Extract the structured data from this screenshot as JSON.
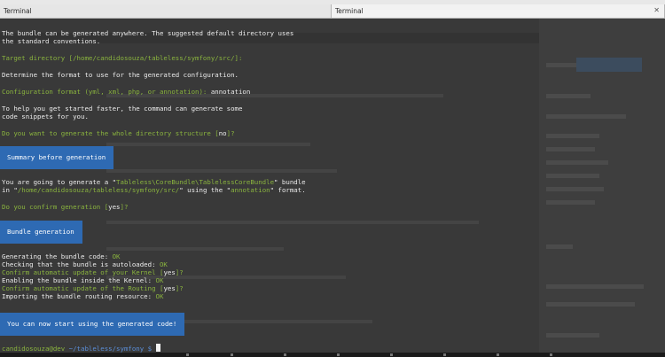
{
  "tabs": [
    {
      "label": "Terminal"
    },
    {
      "label": "Terminal"
    }
  ],
  "terminal": {
    "intro_1": "The bundle can be generated anywhere. The suggested default directory uses",
    "intro_2": "the standard conventions.",
    "target_label": "Target directory [",
    "target_default": "/home/candidosouza/tableless/symfony/src/",
    "target_close": "]:",
    "format_intro": "Determine the format to use for the generated configuration.",
    "format_prompt": "Configuration format (yml, xml, php, or annotation): ",
    "format_answer": "annotation",
    "snippets_1": "To help you get started faster, the command can generate some",
    "snippets_2": "code snippets for you.",
    "structure_prompt": "Do you want to generate the whole directory structure [",
    "structure_default": "no",
    "structure_close": "]?",
    "summary_block": "Summary before generation",
    "gen_1a": "You are going to generate a \"",
    "gen_1b": "Tableless\\CoreBundle\\TablelessCoreBundle",
    "gen_1c": "\" bundle",
    "gen_2a": "in \"",
    "gen_2b": "/home/candidosouza/tableless/symfony/src/",
    "gen_2c": "\" using the \"",
    "gen_2d": "annotation",
    "gen_2e": "\" format.",
    "confirm_prompt": "Do you confirm generation [",
    "confirm_default": "yes",
    "confirm_close": "]?",
    "bundle_block": "Bundle generation",
    "step_code": "Generating the bundle code: ",
    "step_autoload": "Checking that the bundle is autoloaded: ",
    "ok": "OK",
    "kernel_confirm_prompt": "Confirm automatic update of your Kernel [",
    "kernel_confirm_default": "yes",
    "kernel_confirm_close": "]?",
    "step_kernel": "Enabling the bundle inside the Kernel: ",
    "routing_confirm_prompt": "Confirm automatic update of the Routing [",
    "routing_confirm_default": "yes",
    "routing_confirm_close": "]?",
    "step_routing": "Importing the bundle routing resource: ",
    "final_block": "You can now start using the generated code!",
    "prompt_user": "candidosouza@dev",
    "prompt_path": " ~/tableless/symfony $ "
  }
}
